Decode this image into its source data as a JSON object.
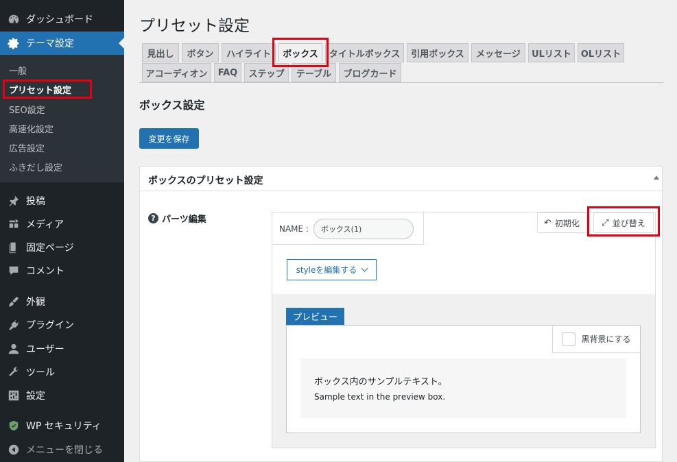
{
  "sidebar": {
    "top_items": [
      {
        "label": "ダッシュボード",
        "icon": "dashboard-icon"
      },
      {
        "label": "テーマ設定",
        "icon": "gear-icon",
        "active": true
      }
    ],
    "submenu": [
      "一般",
      "プリセット設定",
      "SEO設定",
      "高速化設定",
      "広告設定",
      "ふきだし設定"
    ],
    "submenu_current": "プリセット設定",
    "items": [
      {
        "label": "投稿",
        "icon": "pin-icon"
      },
      {
        "label": "メディア",
        "icon": "media-icon"
      },
      {
        "label": "固定ページ",
        "icon": "page-icon"
      },
      {
        "label": "コメント",
        "icon": "comment-icon"
      },
      {
        "label": "外観",
        "icon": "brush-icon"
      },
      {
        "label": "プラグイン",
        "icon": "plugin-icon"
      },
      {
        "label": "ユーザー",
        "icon": "user-icon"
      },
      {
        "label": "ツール",
        "icon": "wrench-icon"
      },
      {
        "label": "設定",
        "icon": "settings-icon"
      },
      {
        "label": "WP セキュリティ",
        "icon": "shield-icon"
      },
      {
        "label": "メニューを閉じる",
        "icon": "collapse-icon"
      }
    ]
  },
  "main": {
    "page_title": "プリセット設定",
    "tabs_row1": [
      "見出し",
      "ボタン",
      "ハイライト",
      "ボックス",
      "タイトルボックス",
      "引用ボックス",
      "メッセージ",
      "ULリスト",
      "OLリスト"
    ],
    "tabs_row2": [
      "アコーディオン",
      "FAQ",
      "ステップ",
      "テーブル",
      "ブログカード"
    ],
    "current_tab": "ボックス",
    "section_title": "ボックス設定",
    "save_label": "変更を保存",
    "panel_title": "ボックスのプリセット設定",
    "parts_label": "パーツ編集",
    "name_label": "NAME :",
    "name_value": "ボックス(1)",
    "reset_label": "初期化",
    "sort_label": "並び替え",
    "style_btn_label": "styleを編集する",
    "preview_label": "プレビュー",
    "darkbg_label": "黒背景にする",
    "sample_text_jp": "ボックス内のサンプルテキスト。",
    "sample_text_en": "Sample text in the preview box."
  },
  "colors": {
    "sidebar_bg": "#1d2327",
    "accent": "#2271b1",
    "highlight_red": "#e60012"
  }
}
